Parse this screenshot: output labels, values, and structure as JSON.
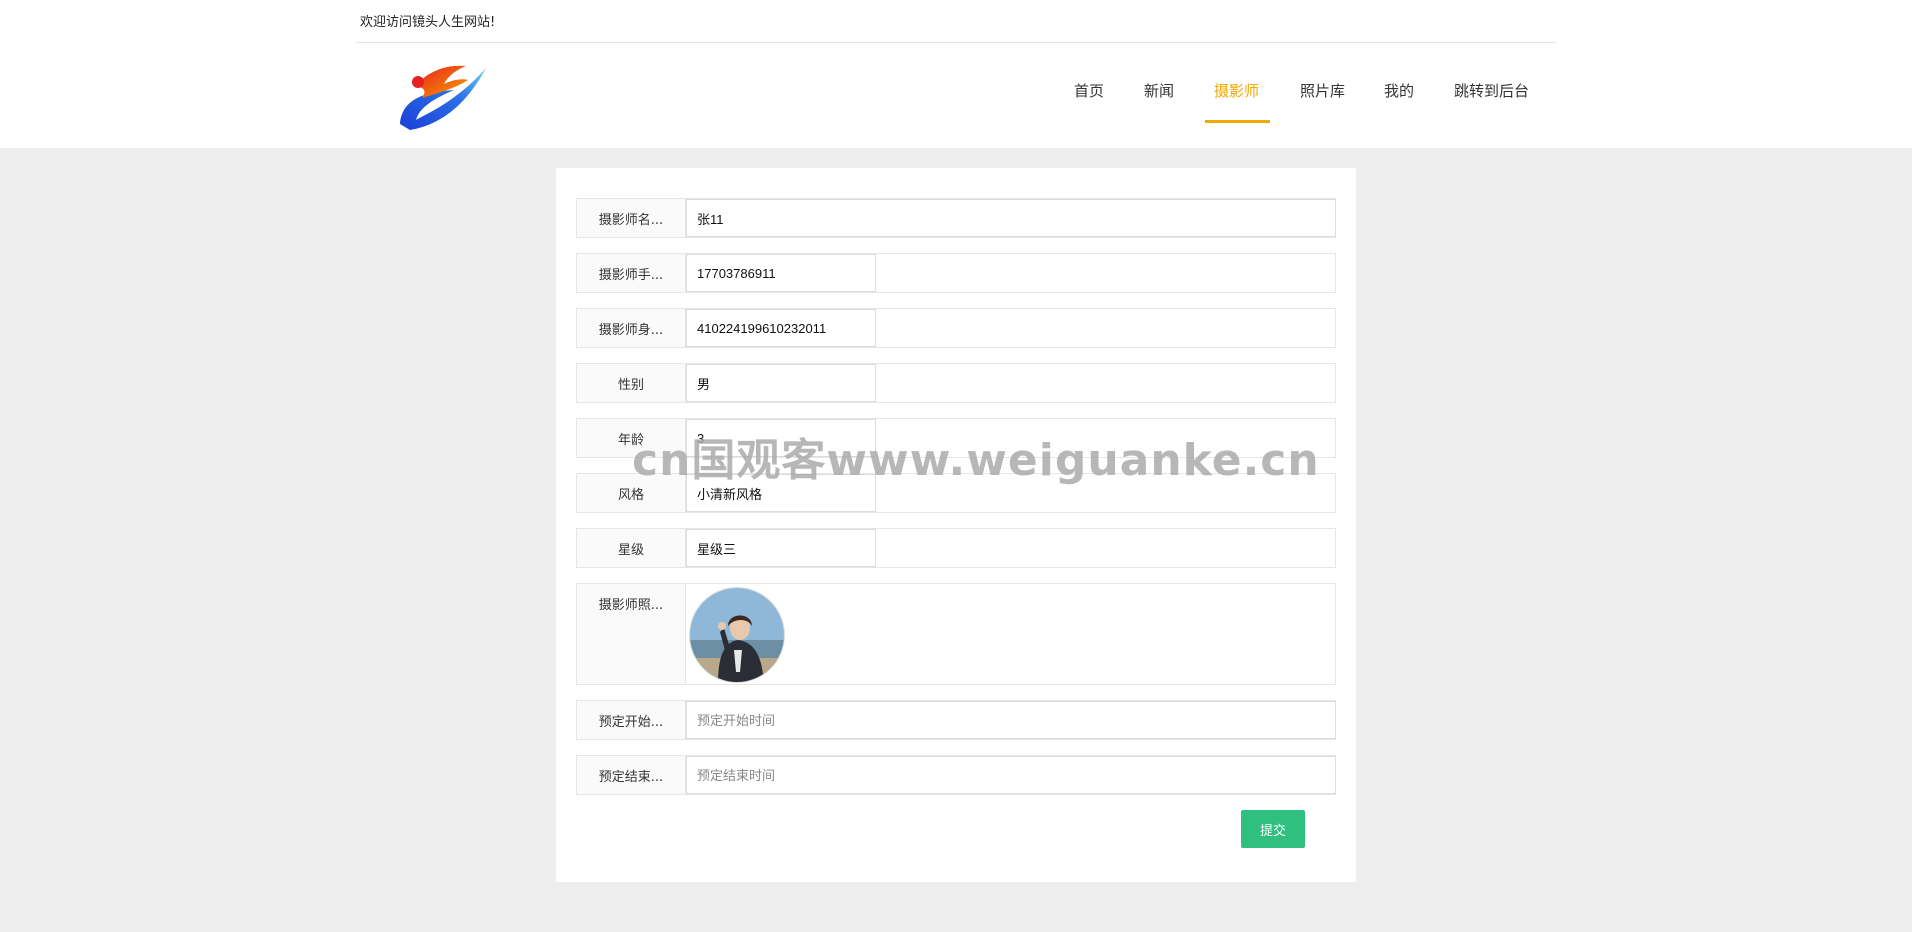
{
  "header": {
    "welcome": "欢迎访问镜头人生网站!"
  },
  "nav": {
    "items": [
      {
        "label": "首页",
        "active": false
      },
      {
        "label": "新闻",
        "active": false
      },
      {
        "label": "摄影师",
        "active": true
      },
      {
        "label": "照片库",
        "active": false
      },
      {
        "label": "我的",
        "active": false
      },
      {
        "label": "跳转到后台",
        "active": false
      }
    ],
    "active_color": "#f0a900"
  },
  "form": {
    "name": {
      "label": "摄影师名...",
      "value": "张11"
    },
    "phone": {
      "label": "摄影师手...",
      "value": "17703786911"
    },
    "idcard": {
      "label": "摄影师身...",
      "value": "410224199610232011"
    },
    "gender": {
      "label": "性别",
      "value": "男"
    },
    "age": {
      "label": "年龄",
      "value": "3"
    },
    "style": {
      "label": "风格",
      "value": "小清新风格"
    },
    "star": {
      "label": "星级",
      "value": "星级三"
    },
    "photo": {
      "label": "摄影师照..."
    },
    "start_time": {
      "label": "预定开始...",
      "placeholder": "预定开始时间"
    },
    "end_time": {
      "label": "预定结束...",
      "placeholder": "预定结束时间"
    },
    "submit_label": "提交",
    "submit_color": "#2fbf7e"
  },
  "watermark": "cn国观客www.weiguanke.cn"
}
